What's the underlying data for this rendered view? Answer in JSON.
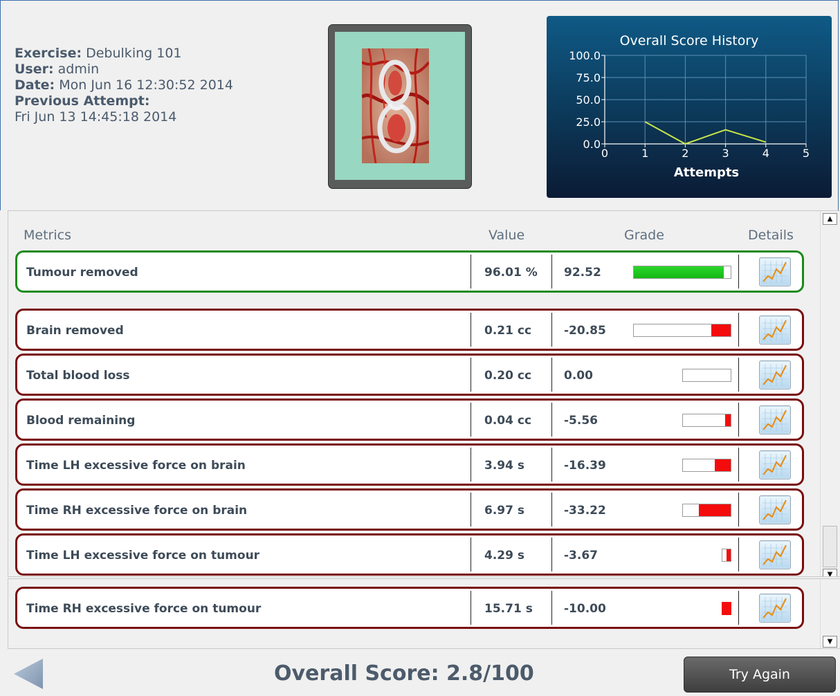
{
  "info": {
    "exercise_label": "Exercise:",
    "exercise_value": "Debulking 101",
    "user_label": "User:",
    "user_value": "admin",
    "date_label": "Date:",
    "date_value": "Mon Jun 16 12:30:52 2014",
    "prev_label": "Previous Attempt:",
    "prev_value": "Fri Jun 13 14:45:18 2014"
  },
  "chart_data": {
    "type": "line",
    "title": "Overall Score History",
    "xlabel": "Attempts",
    "ylabel": "",
    "x": [
      1,
      2,
      3,
      4
    ],
    "y": [
      25.0,
      0.0,
      16.0,
      2.0
    ],
    "xlim": [
      0,
      5
    ],
    "ylim": [
      0,
      100
    ],
    "xticks": [
      "0",
      "1",
      "2",
      "3",
      "4",
      "5"
    ],
    "yticks": [
      "0.0",
      "25.0",
      "50.0",
      "75.0",
      "100.0"
    ],
    "grid": true,
    "line_color": "#c8e64a"
  },
  "table": {
    "headers": {
      "metrics": "Metrics",
      "value": "Value",
      "grade": "Grade",
      "details": "Details"
    },
    "rows": [
      {
        "name": "Tumour removed",
        "value": "96.01 %",
        "grade": "92.52",
        "status": "good",
        "grade_fraction": 0.93
      },
      {
        "name": "Brain removed",
        "value": "0.21 cc",
        "grade": "-20.85",
        "status": "bad",
        "grade_fraction": 0.2
      },
      {
        "name": "Total blood loss",
        "value": "0.20 cc",
        "grade": "0.00",
        "status": "bad",
        "grade_fraction": 0.0
      },
      {
        "name": "Blood remaining",
        "value": "0.04 cc",
        "grade": "-5.56",
        "status": "bad",
        "grade_fraction": 0.11
      },
      {
        "name": "Time LH excessive force on brain",
        "value": "3.94 s",
        "grade": "-16.39",
        "status": "bad",
        "grade_fraction": 0.33
      },
      {
        "name": "Time RH excessive force on brain",
        "value": "6.97 s",
        "grade": "-33.22",
        "status": "bad",
        "grade_fraction": 0.66
      },
      {
        "name": "Time LH excessive force on tumour",
        "value": "4.29 s",
        "grade": "-3.67",
        "status": "bad",
        "grade_fraction": 0.5
      },
      {
        "name": "Time RH excessive force on tumour",
        "value": "15.71 s",
        "grade": "-10.00",
        "status": "bad",
        "grade_fraction": 1.0
      }
    ]
  },
  "footer": {
    "overall_score": "Overall Score: 2.8/100",
    "try_again": "Try Again"
  },
  "colors": {
    "good": "#1b8a1b",
    "bad": "#7a0c0c",
    "bar_red": "#f40c0c",
    "bar_green": "#22cc22"
  },
  "icons": {
    "details": "chart-icon",
    "back": "back-arrow-icon",
    "scroll_up": "scroll-up-icon",
    "scroll_down": "scroll-down-icon"
  }
}
